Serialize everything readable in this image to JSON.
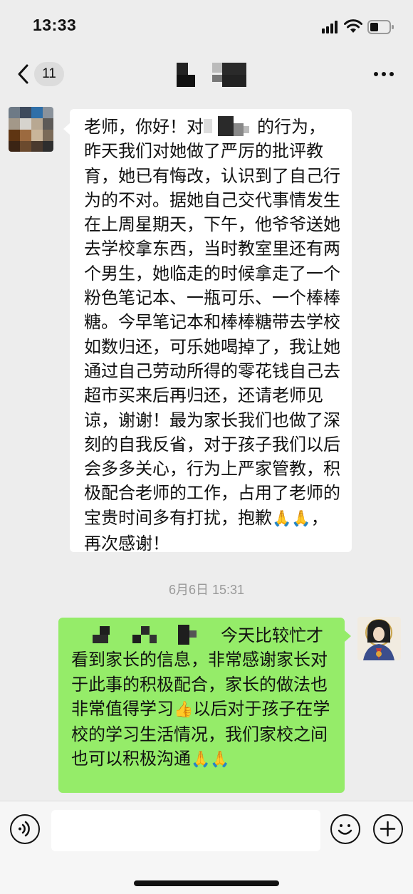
{
  "status_bar": {
    "time": "13:33"
  },
  "nav": {
    "unread_count": "11"
  },
  "messages": [
    {
      "side": "received",
      "text_before_redaction": "老师，你好！对",
      "text_after_redaction": "的行为，昨天我们对她做了严厉的批评教育，她已有悔改，认识到了自己行为的不对。据她自己交代事情发生在上周星期天，下午，他爷爷送她去学校拿东西，当时教室里还有两个男生，她临走的时候拿走了一个粉色笔记本、一瓶可乐、一个棒棒糖。今早笔记本和棒棒糖带去学校如数归还，可乐她喝掉了，我让她通过自己劳动所得的零花钱自己去超市买来后再归还，还请老师见谅，谢谢！最为家长我们也做了深刻的自我反省，对于孩子我们以后会多多关心，行为上严家管教，积极配合老师的工作，占用了老师的宝贵时间多有打扰，抱歉",
      "emoji_tail": "🙏🙏",
      "text_end": "，再次感谢！"
    },
    {
      "side": "sent",
      "text_after_redaction": "今天比较忙才看到家长的信息，非常感谢家长对于此事的积极配合，家长的做法也非常值得学习",
      "emoji_mid": "👍",
      "text_rest": "以后对于孩子在学校的学习生活情况，我们家校之间也可以积极沟通",
      "emoji_tail": "🙏🙏"
    }
  ],
  "timestamp": "6月6日 15:31",
  "icons": {
    "back": "chevron-left-icon",
    "more": "more-dots-icon",
    "voice": "voice-input-icon",
    "emoji": "emoji-face-icon",
    "plus": "plus-icon"
  },
  "colors": {
    "background": "#ededed",
    "received_bubble": "#ffffff",
    "sent_bubble": "#95ec69"
  }
}
